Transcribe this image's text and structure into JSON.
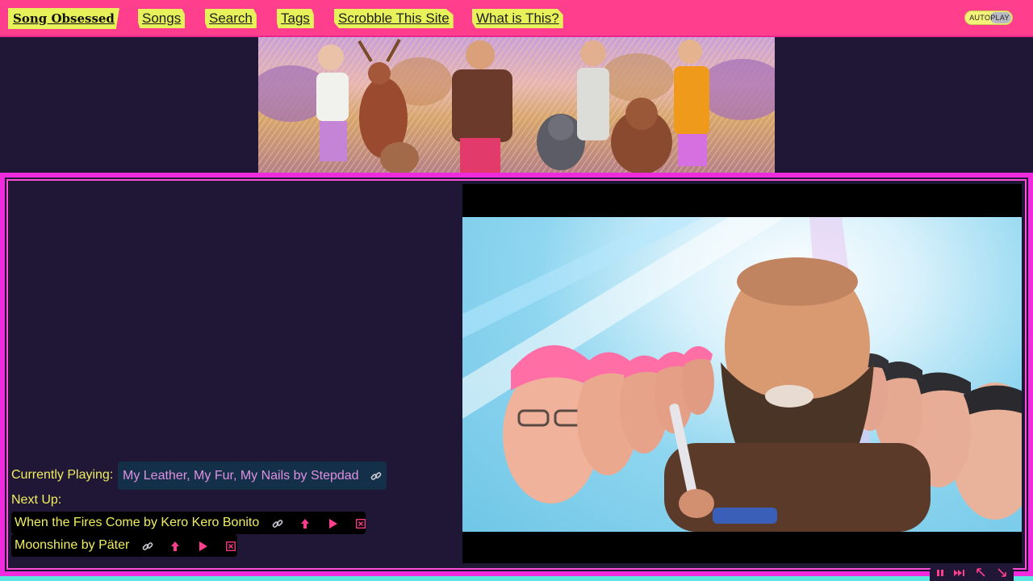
{
  "nav": {
    "brand": "Song Obsessed",
    "links": [
      "Songs",
      "Search",
      "Tags",
      "Scrobble This Site",
      "What is This?"
    ],
    "autoplay_label": "AUTOPLAY",
    "autoplay_on": true
  },
  "player": {
    "current_label": "Currently Playing:",
    "current_title": "My Leather, My Fur, My Nails by Stepdad",
    "next_label": "Next Up:",
    "queue": [
      {
        "title": "When the Fires Come by Kero Kero Bonito"
      },
      {
        "title": "Moonshine by Päter"
      }
    ],
    "controls": [
      "pause-icon",
      "skip-next-icon",
      "expand-icon",
      "collapse-icon"
    ]
  },
  "icons": {
    "link": "link-icon",
    "move_up": "arrow-up-icon",
    "play": "play-icon",
    "remove": "remove-icon"
  },
  "colors": {
    "nav_bg": "#ff3f8e",
    "link_bg": "#e7f25a",
    "page_bg": "#201636",
    "frame_border": "#f02bdd",
    "accent_pink": "#ff3f8e",
    "text_yellow": "#f1ee5d",
    "current_text": "#e08fe2"
  }
}
